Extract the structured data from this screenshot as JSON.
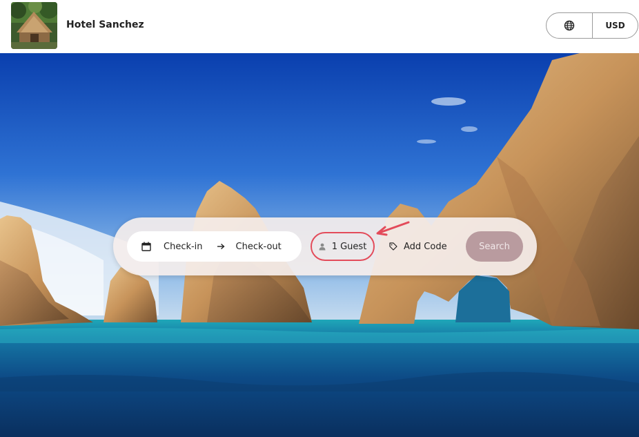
{
  "header": {
    "hotel_name": "Hotel Sanchez",
    "currency": "USD",
    "language_icon": "globe-icon",
    "logo_icon": "hut-logo"
  },
  "search": {
    "checkin_label": "Check-in",
    "checkout_label": "Check-out",
    "guest_label": "1 Guest",
    "code_label": "Add Code",
    "search_label": "Search",
    "icons": {
      "calendar": "calendar-icon",
      "arrow": "arrow-right-icon",
      "guest": "person-icon",
      "code": "tag-icon"
    }
  },
  "colors": {
    "guest_highlight": "#e34b5a",
    "search_button": "#b99b9f",
    "annotation_arrow": "#e34b5a"
  }
}
